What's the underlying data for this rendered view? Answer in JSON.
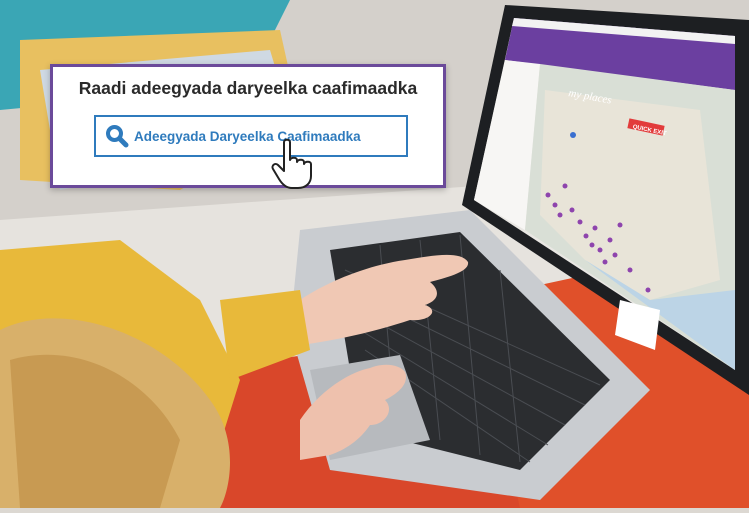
{
  "callout": {
    "title": "Raadi adeegyada daryeelka caafimaadka",
    "search_button_label": "Adeegyada Daryeelka Caafimaadka"
  },
  "screen": {
    "logo": "my places",
    "quick_exit_label": "QUICK EXIT"
  },
  "colors": {
    "callout_border": "#6b4a9a",
    "button_border": "#2f7bbd",
    "button_text": "#2f7bbd",
    "app_header": "#6b3fa0",
    "quick_exit": "#e23b3b",
    "map_pin": "#8e44ad"
  },
  "icons": {
    "search": "search-icon",
    "cursor": "hand-pointer-icon"
  }
}
